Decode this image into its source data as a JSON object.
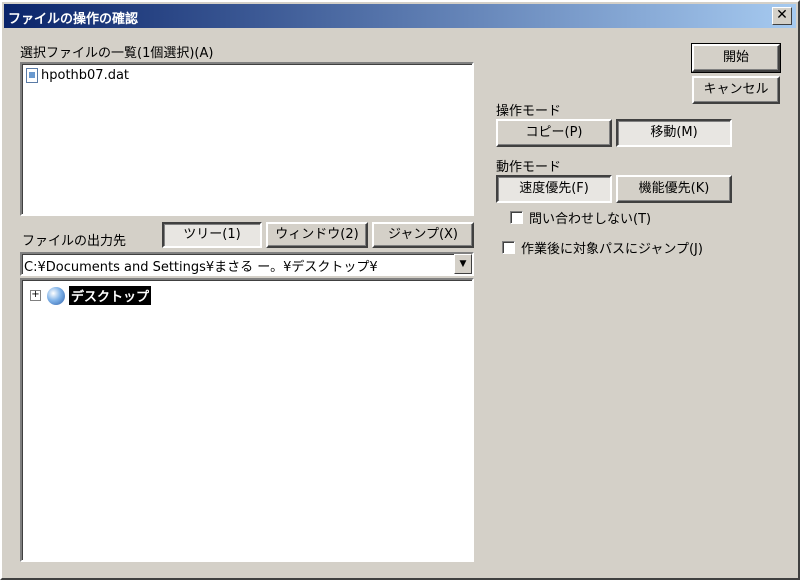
{
  "window": {
    "title": "ファイルの操作の確認",
    "close_label": "✕"
  },
  "file_list": {
    "label": "選択ファイルの一覧(1個選択)(A)",
    "items": [
      "hpothb07.dat"
    ]
  },
  "output": {
    "label": "ファイルの出力先",
    "tabs": [
      "ツリー(1)",
      "ウィンドウ(2)",
      "ジャンプ(X)"
    ],
    "path_value": "C:¥Documents and Settings¥まさる ー。¥デスクトップ¥",
    "tree_root": "デスクトップ"
  },
  "actions": {
    "start": "開始",
    "cancel": "キャンセル"
  },
  "operation_mode": {
    "label": "操作モード",
    "copy": "コピー(P)",
    "move": "移動(M)"
  },
  "behavior_mode": {
    "label": "動作モード",
    "speed": "速度優先(F)",
    "function": "機能優先(K)",
    "no_confirm": "問い合わせしない(T)",
    "jump_after": "作業後に対象パスにジャンプ(J)"
  }
}
